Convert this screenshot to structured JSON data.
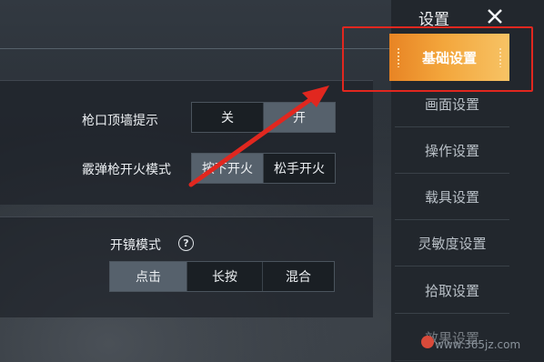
{
  "header": {
    "title": "设置",
    "close_icon": "close-icon"
  },
  "sidebar": {
    "items": [
      {
        "label": "基础设置",
        "active": true
      },
      {
        "label": "画面设置",
        "active": false
      },
      {
        "label": "操作设置",
        "active": false
      },
      {
        "label": "载具设置",
        "active": false
      },
      {
        "label": "灵敏度设置",
        "active": false
      },
      {
        "label": "拾取设置",
        "active": false
      },
      {
        "label": "效果设置",
        "active": false
      }
    ]
  },
  "settings": {
    "muzzle_wall_hint": {
      "label": "枪口顶墙提示",
      "options": [
        "关",
        "开"
      ],
      "selected": "开"
    },
    "shotgun_fire_mode": {
      "label": "霰弹枪开火模式",
      "options": [
        "按下开火",
        "松手开火"
      ],
      "selected": "按下开火"
    },
    "scope_mode": {
      "label": "开镜模式",
      "options": [
        "点击",
        "长按",
        "混合"
      ],
      "selected": "点击",
      "help_icon": "help-icon"
    }
  },
  "watermark": {
    "text": "www.365jz.com"
  },
  "colors": {
    "accent": "#f3a63c",
    "highlight": "#e1271f",
    "selected_option": "#56616c"
  }
}
